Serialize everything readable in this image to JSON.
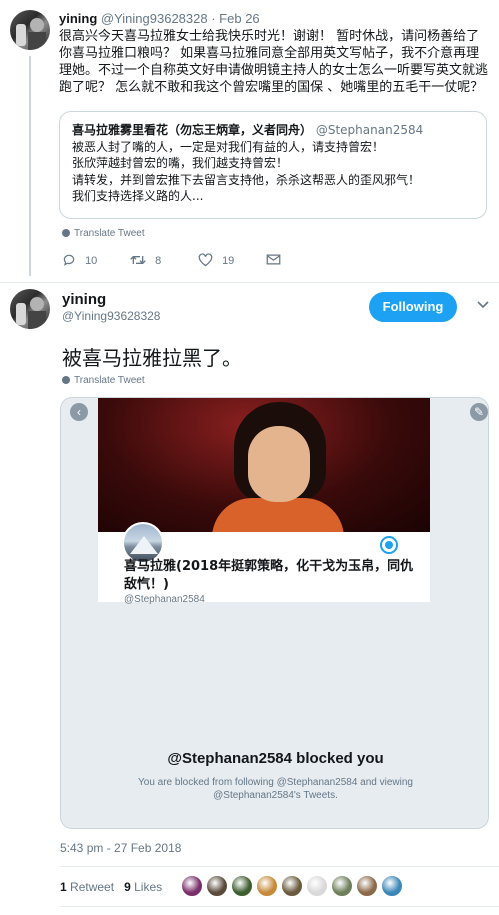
{
  "tweet1": {
    "name": "yining",
    "handle": "@Yining93628328",
    "date": "· Feb 26",
    "text": "很高兴今天喜马拉雅女士给我快乐时光！谢谢！ 暂时休战，请问杨善给了你喜马拉雅口粮吗？ 如果喜马拉雅同意全部用英文写帖子，我不介意再理理她。不过一个自称英文好申请做明镜主持人的女士怎么一听要写英文就逃跑了呢？ 怎么就不敢和我这个曾宏嘴里的国保 、她嘴里的五毛干一仗呢？",
    "quote": {
      "name": "喜马拉雅雾里看花（勿忘王炳章，义者同舟）",
      "handle": "@Stephanan2584",
      "lines": [
        "被恶人封了嘴的人，一定是对我们有益的人，请支持曾宏！",
        "张欣萍越封曾宏的嘴，我们越支持曾宏！",
        "请转发，并到曾宏推下去留言支持他，杀杀这帮恶人的歪风邪气！",
        "我们支持选择义路的人..."
      ]
    },
    "translate": "Translate Tweet",
    "actions": {
      "replies": "10",
      "retweets": "8",
      "likes": "19"
    }
  },
  "tweet2": {
    "name": "yining",
    "handle": "@Yining93628328",
    "follow_label": "Following",
    "text": "被喜马拉雅拉黑了。",
    "translate": "Translate Tweet",
    "card": {
      "profile_name": "喜马拉雅(2018年挺郭策略，化干戈为玉帛，同仇敌忾！)",
      "profile_handle": "@Stephanan2584",
      "blocked_title": "@Stephanan2584 blocked you",
      "blocked_text": "You are blocked from following @Stephanan2584 and viewing @Stephanan2584's Tweets."
    },
    "timestamp": "5:43 pm - 27 Feb 2018",
    "retweet_count": "1",
    "retweet_label": "Retweet",
    "like_count": "9",
    "like_label": "Likes",
    "liker_colors": [
      "#7a2f6b",
      "#5a4a3a",
      "#3d5e2f",
      "#c68a3a",
      "#6b5b3e",
      "#d9d9d9",
      "#6e7f5a",
      "#8a6a4a",
      "#3b87b8"
    ]
  },
  "colors": {
    "accent": "#1da1f2",
    "muted": "#657786",
    "border": "#e6ecf0"
  }
}
